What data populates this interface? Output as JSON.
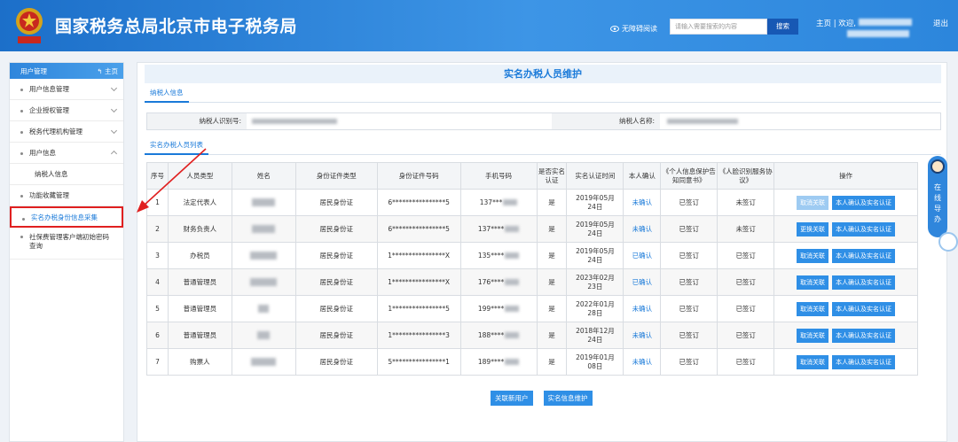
{
  "header": {
    "title": "国家税务总局北京市电子税务局",
    "accessibility": "无障碍阅读",
    "search_placeholder": "请输入需要搜索的内容",
    "search_button": "搜索",
    "home": "主页",
    "welcome": "欢迎,",
    "logout": "退出"
  },
  "sidebar": {
    "header": "用户管理",
    "home_link": "主页",
    "items": [
      {
        "label": "用户信息管理"
      },
      {
        "label": "企业授权管理"
      },
      {
        "label": "税务代理机构管理"
      },
      {
        "label": "用户信息"
      },
      {
        "label": "纳税人信息"
      },
      {
        "label": "功能收藏管理"
      },
      {
        "label": "实名办税身份信息采集"
      },
      {
        "label": "社保费管理客户端初始密码查询"
      }
    ]
  },
  "main": {
    "title": "实名办税人员维护",
    "tab_taxpayer": "纳税人信息",
    "taxpayer_id_label": "纳税人识别号:",
    "taxpayer_name_label": "纳税人名称:",
    "tab_list": "实名办税人员列表",
    "columns": [
      "序号",
      "人员类型",
      "姓名",
      "身份证件类型",
      "身份证件号码",
      "手机号码",
      "是否实名认证",
      "实名认证时间",
      "本人确认",
      "《个人信息保护告知同意书》",
      "《人脸识别服务协议》",
      "操作"
    ],
    "rows": [
      {
        "no": "1",
        "type": "法定代表人",
        "id_type": "居民身份证",
        "id_no": "6****************5",
        "phone": "137***",
        "verified": "是",
        "time": "2019年05月24日",
        "confirm": "未确认",
        "privacy": "已签订",
        "face": "未签订",
        "op1": "取消关联",
        "op2": "本人确认及实名认证"
      },
      {
        "no": "2",
        "type": "财务负责人",
        "id_type": "居民身份证",
        "id_no": "6****************5",
        "phone": "137****",
        "verified": "是",
        "time": "2019年05月24日",
        "confirm": "未确认",
        "privacy": "已签订",
        "face": "未签订",
        "op1": "更换关联",
        "op2": "本人确认及实名认证"
      },
      {
        "no": "3",
        "type": "办税员",
        "id_type": "居民身份证",
        "id_no": "1****************X",
        "phone": "135****",
        "verified": "是",
        "time": "2019年05月24日",
        "confirm": "已确认",
        "privacy": "已签订",
        "face": "已签订",
        "op1": "取消关联",
        "op2": "本人确认及实名认证"
      },
      {
        "no": "4",
        "type": "普通管理员",
        "id_type": "居民身份证",
        "id_no": "1****************X",
        "phone": "176****",
        "verified": "是",
        "time": "2023年02月23日",
        "confirm": "已确认",
        "privacy": "已签订",
        "face": "已签订",
        "op1": "取消关联",
        "op2": "本人确认及实名认证"
      },
      {
        "no": "5",
        "type": "普通管理员",
        "id_type": "居民身份证",
        "id_no": "1****************5",
        "phone": "199****",
        "verified": "是",
        "time": "2022年01月28日",
        "confirm": "未确认",
        "privacy": "已签订",
        "face": "已签订",
        "op1": "取消关联",
        "op2": "本人确认及实名认证"
      },
      {
        "no": "6",
        "type": "普通管理员",
        "id_type": "居民身份证",
        "id_no": "1****************3",
        "phone": "188****",
        "verified": "是",
        "time": "2018年12月24日",
        "confirm": "未确认",
        "privacy": "已签订",
        "face": "已签订",
        "op1": "取消关联",
        "op2": "本人确认及实名认证"
      },
      {
        "no": "7",
        "type": "购票人",
        "id_type": "居民身份证",
        "id_no": "5****************1",
        "phone": "189****",
        "verified": "是",
        "time": "2019年01月08日",
        "confirm": "未确认",
        "privacy": "已签订",
        "face": "已签订",
        "op1": "取消关联",
        "op2": "本人确认及实名认证"
      }
    ],
    "btn_link_user": "关联新用户",
    "btn_maintain": "实名信息维护"
  },
  "guide": {
    "label": "在线导办"
  },
  "colors": {
    "header_blue": "#2c86dc",
    "link_blue": "#1a7ad9",
    "highlight_red": "#e02020"
  }
}
